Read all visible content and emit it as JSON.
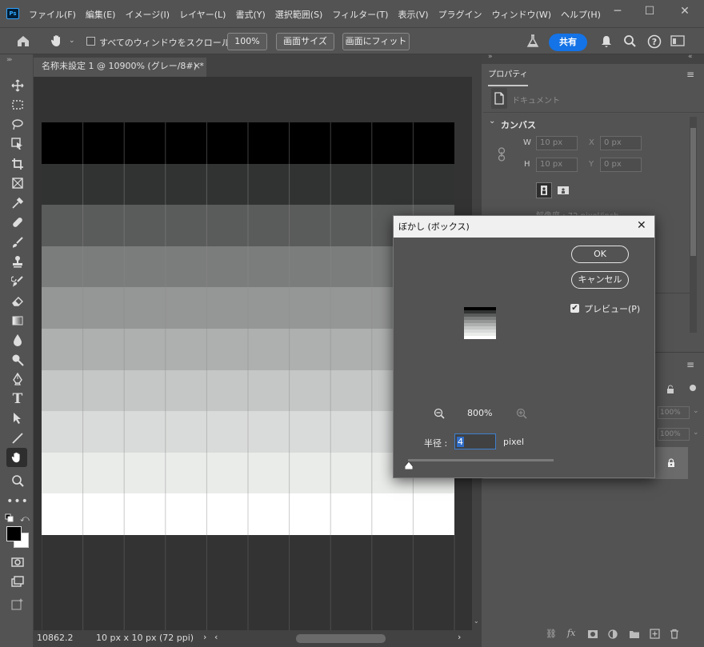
{
  "app": {
    "logo": "Ps",
    "menus": [
      "ファイル(F)",
      "編集(E)",
      "イメージ(I)",
      "レイヤー(L)",
      "書式(Y)",
      "選択範囲(S)",
      "フィルター(T)",
      "表示(V)",
      "プラグイン",
      "ウィンドウ(W)",
      "ヘルプ(H)"
    ]
  },
  "options": {
    "scroll_all": "すべてのウィンドウをスクロール",
    "zoom": "100%",
    "screen_size": "画面サイズ",
    "fit_screen": "画面にフィット",
    "share": "共有"
  },
  "document": {
    "tab_title": "名称未設定 1 @ 10900% (グレー/8#) *",
    "close": "×"
  },
  "canvas": {
    "bands": [
      "#000000",
      "#313232",
      "#5a5b5b",
      "#7b7c7c",
      "#959696",
      "#aeafaf",
      "#c5c7c7",
      "#d9dbda",
      "#eaecea",
      "#ffffff"
    ]
  },
  "status": {
    "zoom": "10862.2",
    "doc_info": "10 px x 10 px (72 ppi)"
  },
  "properties": {
    "tab": "プロパティ",
    "doc_label": "ドキュメント",
    "section": "カンバス",
    "w_label": "W",
    "w_value": "10 px",
    "h_label": "H",
    "h_value": "10 px",
    "x_label": "X",
    "x_value": "0 px",
    "y_label": "Y",
    "y_value": "0 px",
    "resolution": "解像度 : 72 pixel/inch"
  },
  "layers": {
    "opacity1": "100%",
    "opacity2": "100%"
  },
  "dialog": {
    "title": "ぼかし (ボックス)",
    "ok": "OK",
    "cancel": "キャンセル",
    "preview": "プレビュー(P)",
    "zoom": "800%",
    "radius_label": "半径 :",
    "radius_value": "4",
    "unit": "pixel"
  }
}
